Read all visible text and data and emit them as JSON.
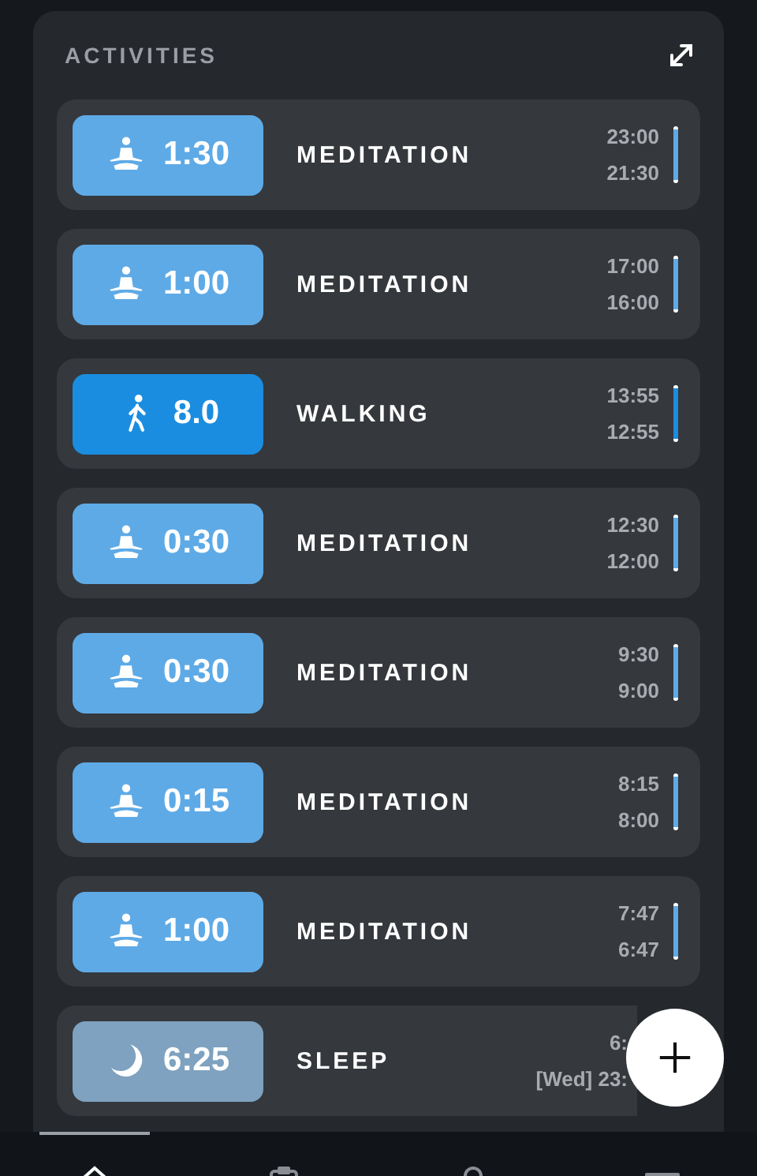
{
  "panel": {
    "title": "ACTIVITIES"
  },
  "activities": [
    {
      "kind": "meditation",
      "duration": "1:30",
      "name": "MEDITATION",
      "end": "23:00",
      "start": "21:30"
    },
    {
      "kind": "meditation",
      "duration": "1:00",
      "name": "MEDITATION",
      "end": "17:00",
      "start": "16:00"
    },
    {
      "kind": "walking",
      "duration": "8.0",
      "name": "WALKING",
      "end": "13:55",
      "start": "12:55"
    },
    {
      "kind": "meditation",
      "duration": "0:30",
      "name": "MEDITATION",
      "end": "12:30",
      "start": "12:00"
    },
    {
      "kind": "meditation",
      "duration": "0:30",
      "name": "MEDITATION",
      "end": "9:30",
      "start": "9:00"
    },
    {
      "kind": "meditation",
      "duration": "0:15",
      "name": "MEDITATION",
      "end": "8:15",
      "start": "8:00"
    },
    {
      "kind": "meditation",
      "duration": "1:00",
      "name": "MEDITATION",
      "end": "7:47",
      "start": "6:47"
    },
    {
      "kind": "sleep",
      "duration": "6:25",
      "name": "SLEEP",
      "end": "6:",
      "start": "[Wed] 23:"
    }
  ]
}
